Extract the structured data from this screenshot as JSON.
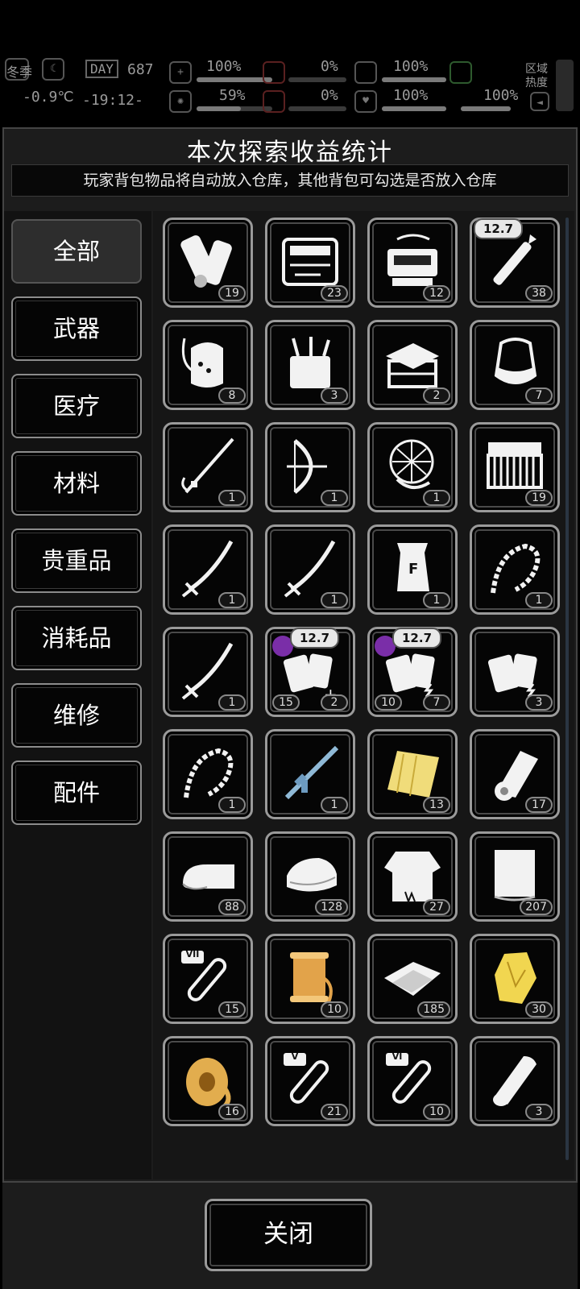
{
  "status_bar": {
    "season": "冬季",
    "temperature": "-0.9℃",
    "day_label": "DAY",
    "day_number": "687",
    "time": "-19:12-",
    "stats_top": [
      "100%",
      "0%",
      "100%"
    ],
    "stats_bottom": [
      "59%",
      "0%",
      "100%",
      "100%"
    ],
    "stat_fill_top": [
      100,
      0,
      100
    ],
    "stat_fill_bottom": [
      59,
      0,
      100,
      100
    ],
    "region_heat": "区域热度"
  },
  "dialog": {
    "title": "本次探索收益统计",
    "notice": "玩家背包物品将自动放入仓库，其他背包可勾选是否放入仓库",
    "close_label": "关闭"
  },
  "categories": [
    "全部",
    "武器",
    "医疗",
    "材料",
    "贵重品",
    "消耗品",
    "维修",
    "配件"
  ],
  "active_category": "全部",
  "items": [
    {
      "icon": "scroll-paper-icon",
      "count": "19"
    },
    {
      "icon": "toolkit-case-icon",
      "count": "23"
    },
    {
      "icon": "electronic-device-icon",
      "count": "12"
    },
    {
      "icon": "rifle-bullet-icon",
      "count": "38",
      "caliber": "12.7"
    },
    {
      "icon": "bag-pack-icon",
      "count": "8"
    },
    {
      "icon": "tool-bucket-icon",
      "count": "3"
    },
    {
      "icon": "toolbox-icon",
      "count": "2"
    },
    {
      "icon": "water-bag-icon",
      "count": "7"
    },
    {
      "icon": "spear-icon",
      "count": "1"
    },
    {
      "icon": "compound-bow-icon",
      "count": "1"
    },
    {
      "icon": "net-icon",
      "count": "1"
    },
    {
      "icon": "ammo-box-icon",
      "count": "19"
    },
    {
      "icon": "katana-icon",
      "count": "1"
    },
    {
      "icon": "katana-icon",
      "count": "1"
    },
    {
      "icon": "fertilizer-bag-icon",
      "count": "1"
    },
    {
      "icon": "thorn-whip-icon",
      "count": "1"
    },
    {
      "icon": "katana-icon",
      "count": "1"
    },
    {
      "icon": "magazine-plus-icon",
      "count": "2",
      "count_left": "15",
      "caliber": "12.7"
    },
    {
      "icon": "magazine-charge-icon",
      "count": "7",
      "count_left": "10",
      "caliber": "12.7"
    },
    {
      "icon": "magazine-charge-icon",
      "count": "3"
    },
    {
      "icon": "thorn-whip-icon",
      "count": "1"
    },
    {
      "icon": "assault-rifle-icon",
      "count": "1"
    },
    {
      "icon": "gold-cloth-icon",
      "count": "13"
    },
    {
      "icon": "paper-roll-icon",
      "count": "17"
    },
    {
      "icon": "towel-icon",
      "count": "88"
    },
    {
      "icon": "folded-clothes-icon",
      "count": "128"
    },
    {
      "icon": "torn-shirt-icon",
      "count": "27"
    },
    {
      "icon": "fabric-sheet-icon",
      "count": "207"
    },
    {
      "icon": "test-tube-vii-icon",
      "count": "15",
      "numeral": "VII"
    },
    {
      "icon": "thread-spool-icon",
      "count": "10"
    },
    {
      "icon": "cloth-pieces-icon",
      "count": "185"
    },
    {
      "icon": "gold-ore-icon",
      "count": "30"
    },
    {
      "icon": "gold-roll-icon",
      "count": "16"
    },
    {
      "icon": "test-tube-v-icon",
      "count": "21",
      "numeral": "V"
    },
    {
      "icon": "test-tube-vi-icon",
      "count": "10",
      "numeral": "VI"
    },
    {
      "icon": "bandage-roll-icon",
      "count": "3"
    }
  ]
}
